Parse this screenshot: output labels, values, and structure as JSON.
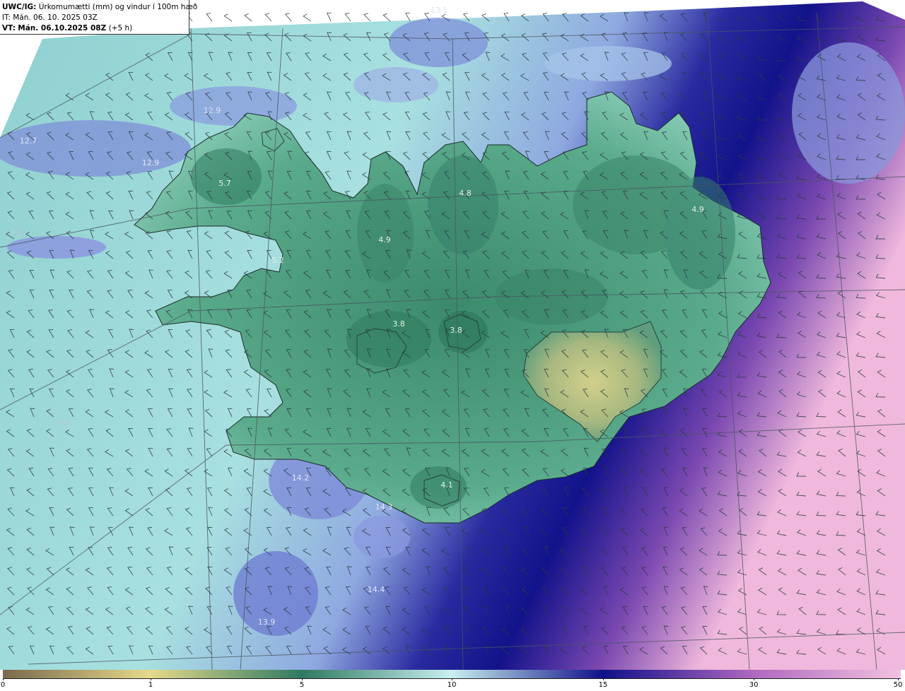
{
  "info": {
    "model_prefix": "UWC/IG:",
    "title": "Úrkomumætti (mm) og vindur í 100m hæð",
    "it_line": "IT: Mán. 06. 10. 2025 03Z",
    "vt_label": "VT:",
    "vt_value": "Mán. 06.10.2025 08Z",
    "vt_offset": "(+5 h)"
  },
  "map_labels": [
    {
      "text": "13.1",
      "kind": "ocean"
    },
    {
      "text": "12.9",
      "kind": "ocean"
    },
    {
      "text": "12.7",
      "kind": "ocean"
    },
    {
      "text": "12.9",
      "kind": "ocean"
    },
    {
      "text": "5.7",
      "kind": "land"
    },
    {
      "text": "4.8",
      "kind": "land"
    },
    {
      "text": "4.9",
      "kind": "land"
    },
    {
      "text": "4.9",
      "kind": "land"
    },
    {
      "text": "5.2",
      "kind": "land"
    },
    {
      "text": "3.8",
      "kind": "land"
    },
    {
      "text": "3.8",
      "kind": "land"
    },
    {
      "text": "4.1",
      "kind": "land"
    },
    {
      "text": "14.2",
      "kind": "ocean"
    },
    {
      "text": "14.3",
      "kind": "ocean"
    },
    {
      "text": "14.4",
      "kind": "ocean"
    },
    {
      "text": "13.9",
      "kind": "ocean"
    },
    {
      "text": "2.0",
      "kind": "faint"
    },
    {
      "text": "10.6",
      "kind": "faint"
    }
  ],
  "colorbar": {
    "ticks": [
      "0",
      "1",
      "5",
      "10",
      "15",
      "30",
      "50"
    ],
    "stops": [
      {
        "value": 0,
        "color": "#7a6a4e"
      },
      {
        "value": 1,
        "color": "#e6d98a"
      },
      {
        "value": 5,
        "color": "#2e7a62"
      },
      {
        "value": 10,
        "color": "#c8f0f0"
      },
      {
        "value": 15,
        "color": "#10108a"
      },
      {
        "value": 30,
        "color": "#b068c0"
      },
      {
        "value": 50,
        "color": "#f0c0e0"
      }
    ]
  },
  "colors": {
    "land_dark": "#3f8a6e",
    "land_light": "#7cc4a8",
    "ocean_light": "#a8dede",
    "ocean_mid": "#7a8fd8",
    "deep_blue": "#15158a",
    "purple": "#7a3fa8",
    "pink": "#f0b8dc",
    "yellow_patch": "#cfcf88"
  }
}
